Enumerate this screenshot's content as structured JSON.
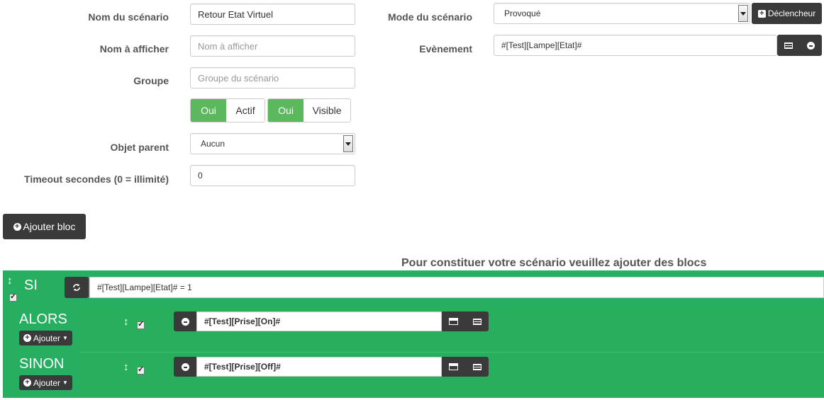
{
  "form": {
    "scenario_name_label": "Nom du scénario",
    "scenario_name_value": "Retour Etat Virtuel",
    "display_name_label": "Nom à afficher",
    "display_name_placeholder": "Nom à afficher",
    "group_label": "Groupe",
    "group_placeholder": "Groupe du scénario",
    "active_toggle": {
      "on": "Oui",
      "label": "Actif"
    },
    "visible_toggle": {
      "on": "Oui",
      "label": "Visible"
    },
    "parent_label": "Objet parent",
    "parent_value": "Aucun",
    "timeout_label": "Timeout secondes (0 = illimité)",
    "timeout_value": "0",
    "mode_label": "Mode du scénario",
    "mode_value": "Provoqué",
    "trigger_button": "Déclencheur",
    "event_label": "Evènement",
    "event_value": "#[Test][Lampe][Etat]#"
  },
  "add_block_button": "Ajouter bloc",
  "info_message": "Pour constituer votre scénario veuillez ajouter des blocs",
  "blocks": {
    "si_label": "SI",
    "condition": "#[Test][Lampe][Etat]# = 1",
    "alors_label": "ALORS",
    "alors_action": "#[Test][Prise][On]#",
    "sinon_label": "SINON",
    "sinon_action": "#[Test][Prise][Off]#",
    "add_label": "Ajouter"
  },
  "colors": {
    "block_green": "#27ae60",
    "toggle_green": "#5cb85c",
    "dark_button": "#3a3a3a"
  }
}
